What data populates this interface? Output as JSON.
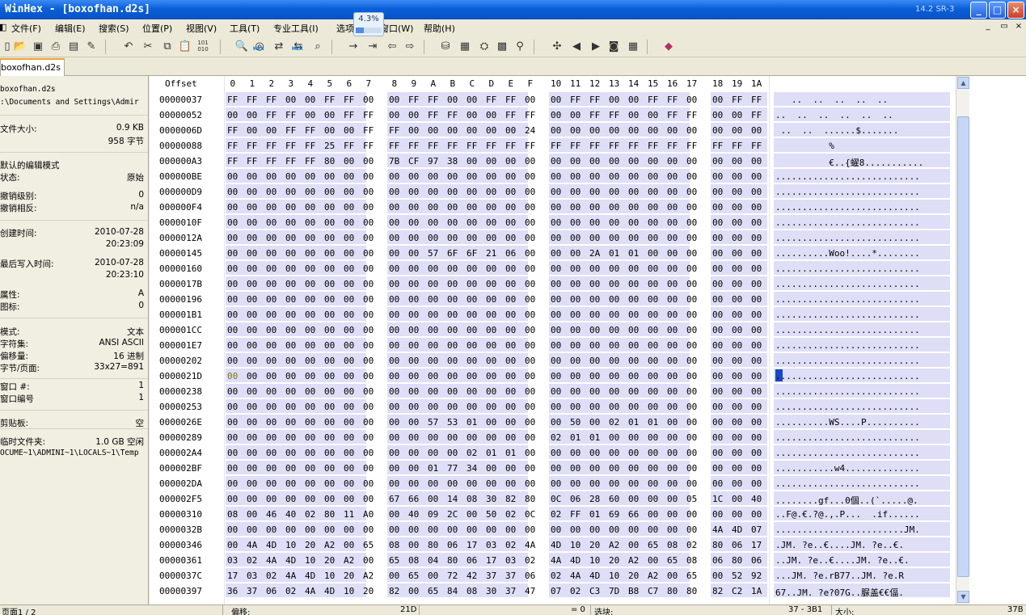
{
  "window": {
    "title": "WinHex - [boxofhan.d2s]",
    "version": "14.2 SR-3",
    "buttons": {
      "minimize": "_",
      "maximize": "□",
      "close": "×"
    }
  },
  "menu": {
    "items": [
      "文件(F)",
      "编辑(E)",
      "搜索(S)",
      "位置(P)",
      "视图(V)",
      "工具(T)",
      "专业工具(I)",
      "选项",
      "窗口(W)",
      "帮助(H)"
    ],
    "mdi": {
      "minimize": "_",
      "restore": "▭",
      "close": "×"
    }
  },
  "progress": {
    "label": "4.3%",
    "value": 0.043
  },
  "toolbar": {
    "hex_label": "HEX",
    "binary_label": "101 010"
  },
  "tab": {
    "label": "boxofhan.d2s"
  },
  "sidebar": {
    "filename": "boxofhan.d2s",
    "path": ":\\Documents and Settings\\Admir",
    "rows": [
      {
        "key": "文件大小:",
        "value": "0.9 KB"
      },
      {
        "key": "",
        "value": "958 字节"
      },
      {
        "key": "默认的编辑模式",
        "value": ""
      },
      {
        "key": "状态:",
        "value": "原始"
      },
      {
        "key": "撤销级别:",
        "value": "0"
      },
      {
        "key": "撤销相反:",
        "value": "n/a"
      },
      {
        "key": "创建时间:",
        "value": "2010-07-28"
      },
      {
        "key": "",
        "value": "20:23:09"
      },
      {
        "key": "最后写入时间:",
        "value": "2010-07-28"
      },
      {
        "key": "",
        "value": "20:23:10"
      },
      {
        "key": "属性:",
        "value": "A"
      },
      {
        "key": "图标:",
        "value": "0"
      },
      {
        "key": "模式:",
        "value": "文本"
      },
      {
        "key": "字符集:",
        "value": "ANSI ASCII"
      },
      {
        "key": "偏移量:",
        "value": "16 进制"
      },
      {
        "key": "字节/页面:",
        "value": "33x27=891"
      },
      {
        "key": "窗口 #:",
        "value": "1"
      },
      {
        "key": "窗口编号",
        "value": "1"
      },
      {
        "key": "剪贴板:",
        "value": "空"
      },
      {
        "key": "临时文件夹:",
        "value": "1.0 GB 空闲"
      }
    ],
    "temp_path": "OCUME~1\\ADMINI~1\\LOCALS~1\\Temp"
  },
  "hex": {
    "header_offset": "Offset",
    "columns": [
      "0",
      "1",
      "2",
      "3",
      "4",
      "5",
      "6",
      "7",
      "8",
      "9",
      "A",
      "B",
      "C",
      "D",
      "E",
      "F",
      "10",
      "11",
      "12",
      "13",
      "14",
      "15",
      "16",
      "17",
      "18",
      "19",
      "1A"
    ],
    "rows": [
      {
        "offset": "00000037",
        "bytes": "FF FF FF 00 00 FF FF 00 00 FF FF 00 00 FF FF 00 00 FF FF 00 00 FF FF 00 00 FF FF",
        "text": "   ..  ..  ..  ..  .."
      },
      {
        "offset": "00000052",
        "bytes": "00 00 FF FF 00 00 FF FF 00 00 FF FF 00 00 FF FF 00 00 FF FF 00 00 FF FF 00 00 FF",
        "text": "..  ..  ..  ..  ..  .."
      },
      {
        "offset": "0000006D",
        "bytes": "FF 00 00 FF FF 00 00 FF FF 00 00 00 00 00 00 24 00 00 00 00 00 00 00 00 00 00 00",
        "text": " ..  ..  ......$......."
      },
      {
        "offset": "00000088",
        "bytes": "FF FF FF FF FF 25 FF FF FF FF FF FF FF FF FF FF FF FF FF FF FF FF FF FF FF FF FF",
        "text": "          %"
      },
      {
        "offset": "000000A3",
        "bytes": "FF FF FF FF FF 80 00 00 7B CF 97 38 00 00 00 00 00 00 00 00 00 00 00 00 00 00 00",
        "text": "          €..{蠗8..........."
      },
      {
        "offset": "000000BE",
        "bytes": "00 00 00 00 00 00 00 00 00 00 00 00 00 00 00 00 00 00 00 00 00 00 00 00 00 00 00",
        "text": "..........................."
      },
      {
        "offset": "000000D9",
        "bytes": "00 00 00 00 00 00 00 00 00 00 00 00 00 00 00 00 00 00 00 00 00 00 00 00 00 00 00",
        "text": "..........................."
      },
      {
        "offset": "000000F4",
        "bytes": "00 00 00 00 00 00 00 00 00 00 00 00 00 00 00 00 00 00 00 00 00 00 00 00 00 00 00",
        "text": "..........................."
      },
      {
        "offset": "0000010F",
        "bytes": "00 00 00 00 00 00 00 00 00 00 00 00 00 00 00 00 00 00 00 00 00 00 00 00 00 00 00",
        "text": "..........................."
      },
      {
        "offset": "0000012A",
        "bytes": "00 00 00 00 00 00 00 00 00 00 00 00 00 00 00 00 00 00 00 00 00 00 00 00 00 00 00",
        "text": "..........................."
      },
      {
        "offset": "00000145",
        "bytes": "00 00 00 00 00 00 00 00 00 00 57 6F 6F 21 06 00 00 00 2A 01 01 00 00 00 00 00 00",
        "text": "..........Woo!....*........"
      },
      {
        "offset": "00000160",
        "bytes": "00 00 00 00 00 00 00 00 00 00 00 00 00 00 00 00 00 00 00 00 00 00 00 00 00 00 00",
        "text": "..........................."
      },
      {
        "offset": "0000017B",
        "bytes": "00 00 00 00 00 00 00 00 00 00 00 00 00 00 00 00 00 00 00 00 00 00 00 00 00 00 00",
        "text": "..........................."
      },
      {
        "offset": "00000196",
        "bytes": "00 00 00 00 00 00 00 00 00 00 00 00 00 00 00 00 00 00 00 00 00 00 00 00 00 00 00",
        "text": "..........................."
      },
      {
        "offset": "000001B1",
        "bytes": "00 00 00 00 00 00 00 00 00 00 00 00 00 00 00 00 00 00 00 00 00 00 00 00 00 00 00",
        "text": "..........................."
      },
      {
        "offset": "000001CC",
        "bytes": "00 00 00 00 00 00 00 00 00 00 00 00 00 00 00 00 00 00 00 00 00 00 00 00 00 00 00",
        "text": "..........................."
      },
      {
        "offset": "000001E7",
        "bytes": "00 00 00 00 00 00 00 00 00 00 00 00 00 00 00 00 00 00 00 00 00 00 00 00 00 00 00",
        "text": "..........................."
      },
      {
        "offset": "00000202",
        "bytes": "00 00 00 00 00 00 00 00 00 00 00 00 00 00 00 00 00 00 00 00 00 00 00 00 00 00 00",
        "text": "..........................."
      },
      {
        "offset": "0000021D",
        "bytes": "00 00 00 00 00 00 00 00 00 00 00 00 00 00 00 00 00 00 00 00 00 00 00 00 00 00 00",
        "text": "..........................."
      },
      {
        "offset": "00000238",
        "bytes": "00 00 00 00 00 00 00 00 00 00 00 00 00 00 00 00 00 00 00 00 00 00 00 00 00 00 00",
        "text": "..........................."
      },
      {
        "offset": "00000253",
        "bytes": "00 00 00 00 00 00 00 00 00 00 00 00 00 00 00 00 00 00 00 00 00 00 00 00 00 00 00",
        "text": "..........................."
      },
      {
        "offset": "0000026E",
        "bytes": "00 00 00 00 00 00 00 00 00 00 57 53 01 00 00 00 00 50 00 02 01 01 00 00 00 00 00",
        "text": "..........WS....P.........."
      },
      {
        "offset": "00000289",
        "bytes": "00 00 00 00 00 00 00 00 00 00 00 00 00 00 00 00 02 01 01 00 00 00 00 00 00 00 00",
        "text": "..........................."
      },
      {
        "offset": "000002A4",
        "bytes": "00 00 00 00 00 00 00 00 00 00 00 00 02 01 01 00 00 00 00 00 00 00 00 00 00 00 00",
        "text": "..........................."
      },
      {
        "offset": "000002BF",
        "bytes": "00 00 00 00 00 00 00 00 00 00 01 77 34 00 00 00 00 00 00 00 00 00 00 00 00 00 00",
        "text": "...........w4.............."
      },
      {
        "offset": "000002DA",
        "bytes": "00 00 00 00 00 00 00 00 00 00 00 00 00 00 00 00 00 00 00 00 00 00 00 00 00 00 00",
        "text": "..........................."
      },
      {
        "offset": "000002F5",
        "bytes": "00 00 00 00 00 00 00 00 67 66 00 14 08 30 82 80 0C 06 28 60 00 00 00 05 1C 00 40 01",
        "text": "........gf...0個..(`.....@."
      },
      {
        "offset": "00000310",
        "bytes": "08 00 46 40 02 80 11 A0 00 40 09 2C 00 50 02 0C 02 FF 01 69 66 00 00 00 00 00 00",
        "text": "..F@.€.?@.,.P...  .if......"
      },
      {
        "offset": "0000032B",
        "bytes": "00 00 00 00 00 00 00 00 00 00 00 00 00 00 00 00 00 00 00 00 00 00 00 00 4A 4D 07",
        "text": "........................JM."
      },
      {
        "offset": "00000346",
        "bytes": "00 4A 4D 10 20 A2 00 65 08 00 80 06 17 03 02 4A 4D 10 20 A2 00 65 08 02 80 06 17",
        "text": ".JM. ?e..€....JM. ?e..€."
      },
      {
        "offset": "00000361",
        "bytes": "03 02 4A 4D 10 20 A2 00 65 08 04 80 06 17 03 02 4A 4D 10 20 A2 00 65 08 06 80 06",
        "text": "..JM. ?e..€....JM. ?e..€."
      },
      {
        "offset": "0000037C",
        "bytes": "17 03 02 4A 4D 10 20 A2 00 65 00 72 42 37 37 06 02 4A 4D 10 20 A2 00 65 00 52 92",
        "text": "...JM. ?e.rB77..JM. ?e.R"
      },
      {
        "offset": "00000397",
        "bytes": "36 37 06 02 4A 4D 10 20 82 00 65 84 08 30 37 47 07 02 C3 7D B8 C7 80 80 82 C2 1A",
        "text": "67..JM. ?e?07G..脲盖€€偪."
      }
    ],
    "cursor_offset": "0000021D"
  },
  "status": {
    "page": "页面1 / 2",
    "offset_label": "偏移:",
    "offset_value": "21D",
    "value": "= 0",
    "selection_label": "选块:",
    "selection_value": "37 - 3B1",
    "size_label": "大小:",
    "size_value": "37B"
  }
}
